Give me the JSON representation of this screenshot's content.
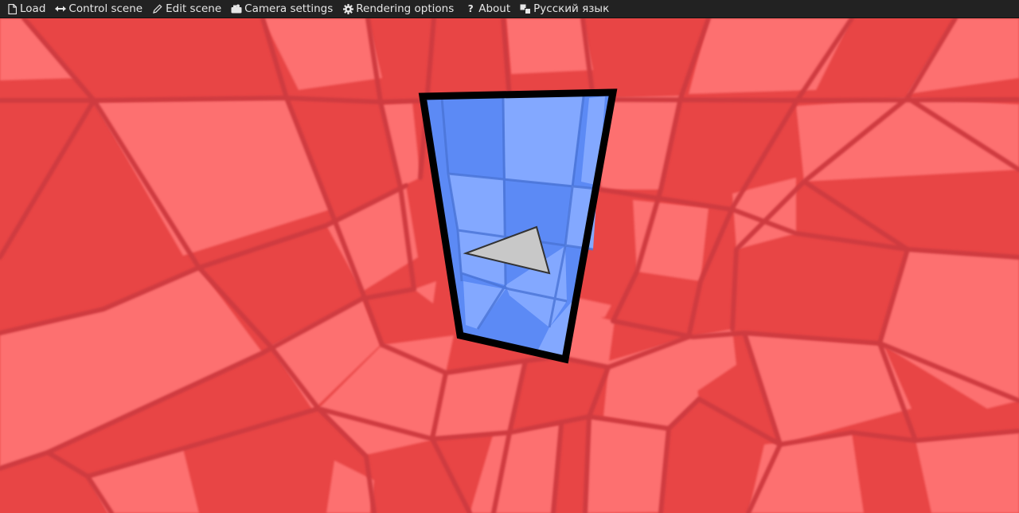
{
  "menu": {
    "load": "Load",
    "control_scene": "Control scene",
    "edit_scene": "Edit scene",
    "camera_settings": "Camera settings",
    "rendering_options": "Rendering options",
    "about": "About",
    "language": "Русский язык"
  },
  "icons": {
    "load": "file-icon",
    "control_scene": "arrows-horizontal-icon",
    "edit_scene": "pencil-icon",
    "camera_settings": "camera-icon",
    "rendering_options": "gear-icon",
    "about": "question-icon",
    "language": "language-icon"
  },
  "colors": {
    "menubar_bg": "#222222",
    "menu_text": "#e6e6e6",
    "tile_dark": "#e84545",
    "tile_light": "#fd7070",
    "grout": "#cf3b41",
    "portal_fill": "#5c8af5",
    "portal_light": "#83a8ff",
    "portal_frame": "#000000",
    "triangle": "#c8c8c8"
  }
}
